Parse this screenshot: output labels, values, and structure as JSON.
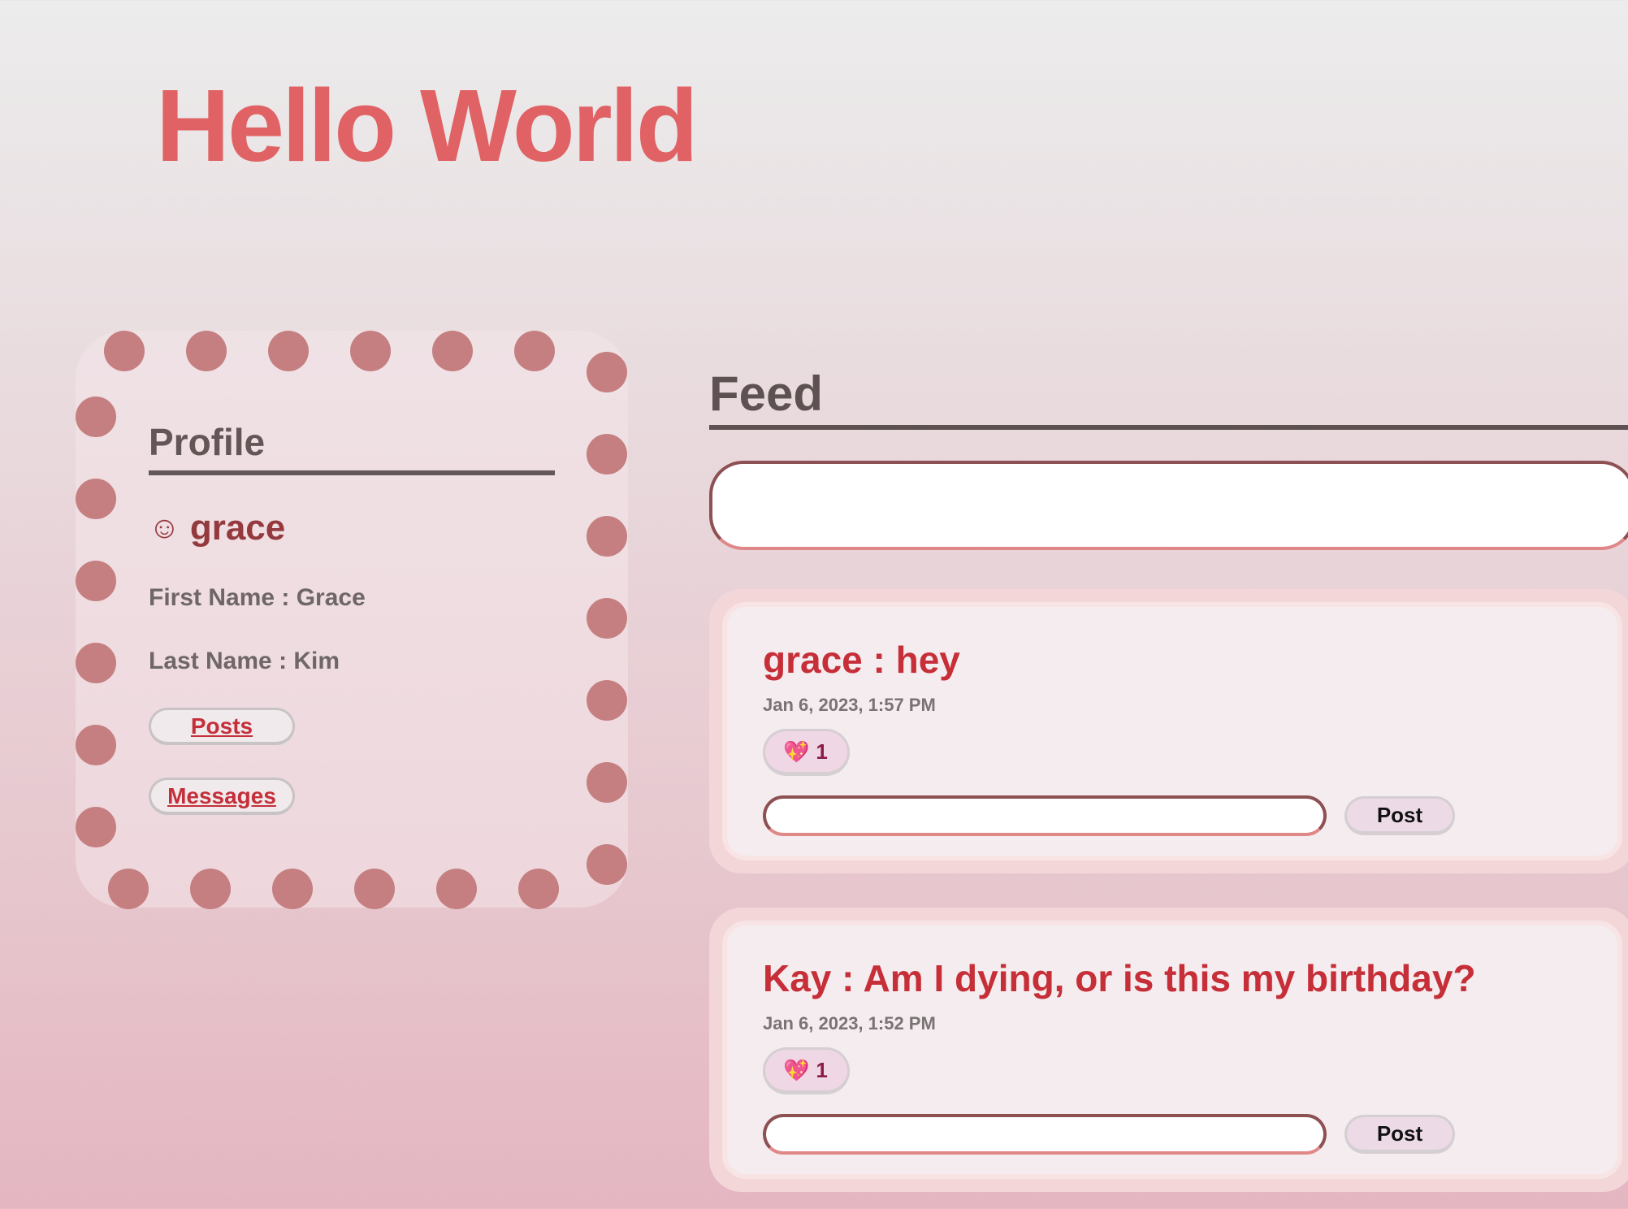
{
  "hero": {
    "title": "Hello World"
  },
  "profile": {
    "heading": "Profile",
    "smile_icon": "☺",
    "username": "grace",
    "first_name_line": "First Name : Grace",
    "last_name_line": "Last Name : Kim",
    "posts_link": "Posts",
    "messages_link": "Messages"
  },
  "feed": {
    "heading": "Feed",
    "new_post_value": "",
    "posts": [
      {
        "title": "grace : hey",
        "time": "Jan 6, 2023, 1:57 PM",
        "reaction_icon": "💖",
        "reaction_count": "1",
        "comment_value": "",
        "post_button": "Post"
      },
      {
        "title": "Kay : Am I dying, or is this my birthday?",
        "time": "Jan 6, 2023, 1:52 PM",
        "reaction_icon": "💖",
        "reaction_count": "1",
        "comment_value": "",
        "post_button": "Post"
      }
    ]
  },
  "colors": {
    "accent": "#e06264",
    "dots": "#c57f80",
    "post_title": "#c62e38"
  }
}
